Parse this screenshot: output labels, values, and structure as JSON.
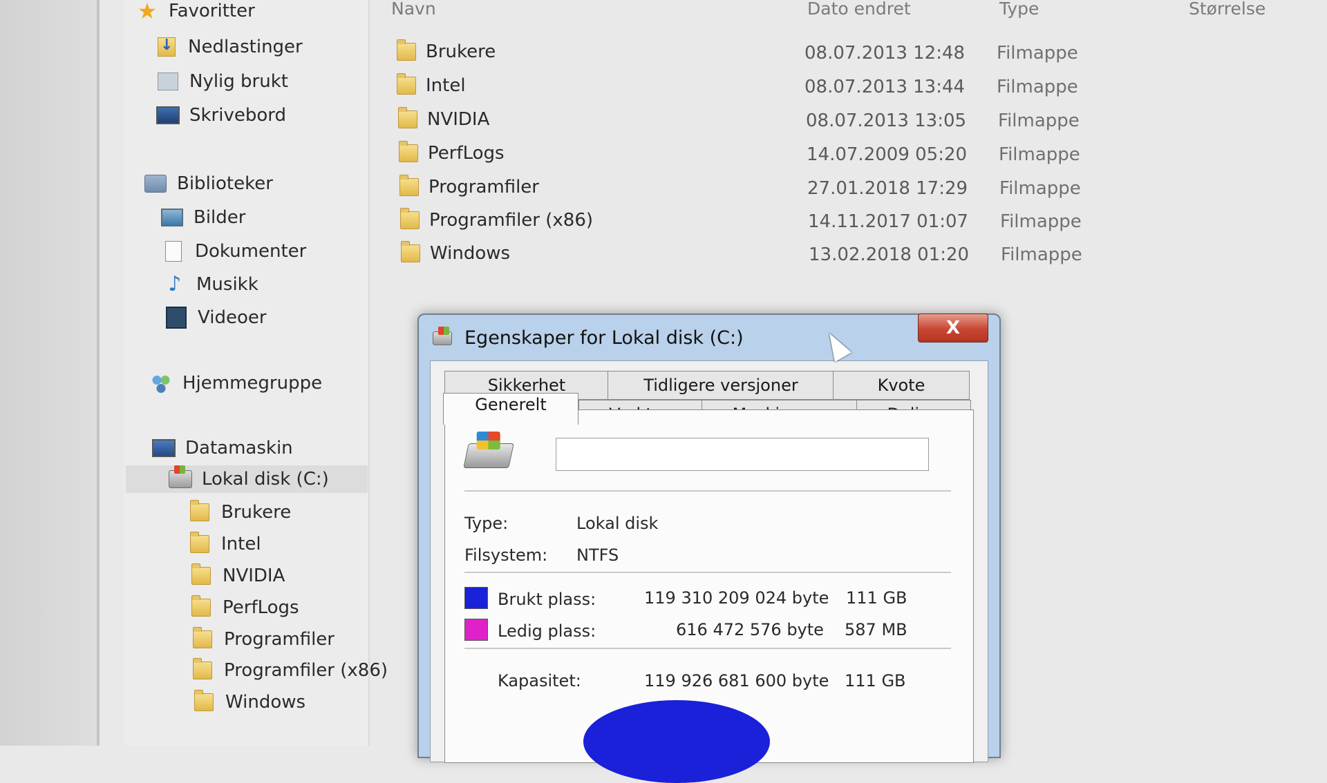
{
  "nav": {
    "favorites": {
      "label": "Favoritter",
      "items": [
        {
          "label": "Nedlastinger",
          "icon": "downloads-icon"
        },
        {
          "label": "Nylig brukt",
          "icon": "recent-places-icon"
        },
        {
          "label": "Skrivebord",
          "icon": "desktop-icon"
        }
      ]
    },
    "libraries": {
      "label": "Biblioteker",
      "items": [
        {
          "label": "Bilder",
          "icon": "pictures-icon"
        },
        {
          "label": "Dokumenter",
          "icon": "documents-icon"
        },
        {
          "label": "Musikk",
          "icon": "music-icon"
        },
        {
          "label": "Videoer",
          "icon": "videos-icon"
        }
      ]
    },
    "homegroup": {
      "label": "Hjemmegruppe"
    },
    "computer": {
      "label": "Datamaskin",
      "drive": "Lokal disk (C:)",
      "subfolders": [
        "Brukere",
        "Intel",
        "NVIDIA",
        "PerfLogs",
        "Programfiler",
        "Programfiler (x86)",
        "Windows"
      ]
    }
  },
  "columns": {
    "name": "Navn",
    "date": "Dato endret",
    "type": "Type",
    "size": "Størrelse"
  },
  "files": [
    {
      "name": "Brukere",
      "date": "08.07.2013 12:48",
      "type": "Filmappe"
    },
    {
      "name": "Intel",
      "date": "08.07.2013 13:44",
      "type": "Filmappe"
    },
    {
      "name": "NVIDIA",
      "date": "08.07.2013 13:05",
      "type": "Filmappe"
    },
    {
      "name": "PerfLogs",
      "date": "14.07.2009 05:20",
      "type": "Filmappe"
    },
    {
      "name": "Programfiler",
      "date": "27.01.2018 17:29",
      "type": "Filmappe"
    },
    {
      "name": "Programfiler (x86)",
      "date": "14.11.2017 01:07",
      "type": "Filmappe"
    },
    {
      "name": "Windows",
      "date": "13.02.2018 01:20",
      "type": "Filmappe"
    }
  ],
  "dialog": {
    "title": "Egenskaper for Lokal disk (C:)",
    "close_label": "X",
    "tabs_row1": [
      "Sikkerhet",
      "Tidligere versjoner",
      "Kvote"
    ],
    "tabs_row2": [
      "Generelt",
      "Verktøy",
      "Maskinvare",
      "Deling"
    ],
    "active_tab": "Generelt",
    "name_value": "",
    "type_label": "Type:",
    "type_value": "Lokal disk",
    "fs_label": "Filsystem:",
    "fs_value": "NTFS",
    "used_label": "Brukt plass:",
    "used_bytes": "119 310 209 024 byte",
    "used_size": "111 GB",
    "used_color": "#1a21d8",
    "free_label": "Ledig plass:",
    "free_bytes": "616 472 576 byte",
    "free_size": "587 MB",
    "free_color": "#e020c8",
    "capacity_label": "Kapasitet:",
    "capacity_bytes": "119 926 681 600 byte",
    "capacity_size": "111 GB"
  }
}
